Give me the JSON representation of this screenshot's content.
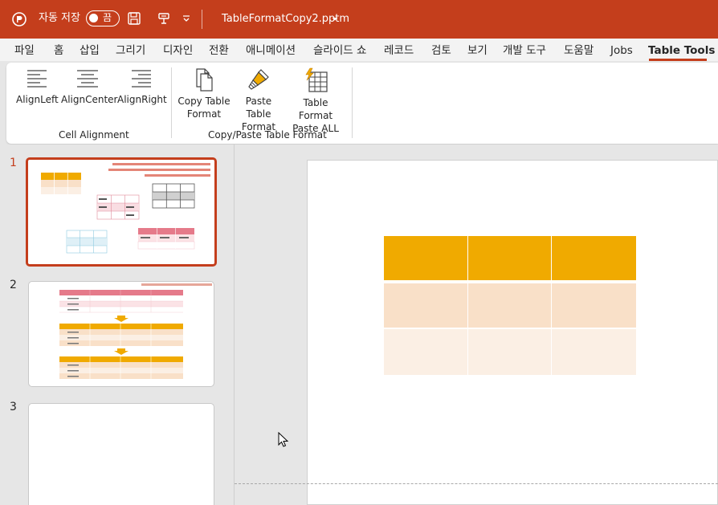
{
  "titlebar": {
    "autosave_label": "자동 저장",
    "toggle_state": "끔",
    "filename": "TableFormatCopy2.pptm",
    "bg_color": "#c43e1c"
  },
  "tabs": [
    {
      "label": "파일"
    },
    {
      "label": "홈"
    },
    {
      "label": "삽입"
    },
    {
      "label": "그리기"
    },
    {
      "label": "디자인"
    },
    {
      "label": "전환"
    },
    {
      "label": "애니메이션"
    },
    {
      "label": "슬라이드 쇼"
    },
    {
      "label": "레코드"
    },
    {
      "label": "검토"
    },
    {
      "label": "보기"
    },
    {
      "label": "개발 도구"
    },
    {
      "label": "도움말"
    },
    {
      "label": "Jobs"
    },
    {
      "label": "Table Tools",
      "active": true
    }
  ],
  "ribbon": {
    "align_left": "AlignLeft",
    "align_center": "AlignCenter",
    "align_right": "AlignRight",
    "group_cell_alignment": "Cell Alignment",
    "copy_table_format_1": "Copy Table",
    "copy_table_format_2": "Format",
    "paste_table_format_1": "Paste Table",
    "paste_table_format_2": "Format",
    "paste_all_1": "Table Format",
    "paste_all_2": "Paste ALL",
    "group_copy_paste": "Copy/Paste Table Format"
  },
  "slides": [
    {
      "number": "1",
      "active": true
    },
    {
      "number": "2"
    },
    {
      "number": "3"
    }
  ],
  "colors": {
    "accent": "#c43e1c",
    "table_header": "#f0aa00",
    "table_row1": "#f9e0c8",
    "table_row2": "#fbefe4"
  }
}
